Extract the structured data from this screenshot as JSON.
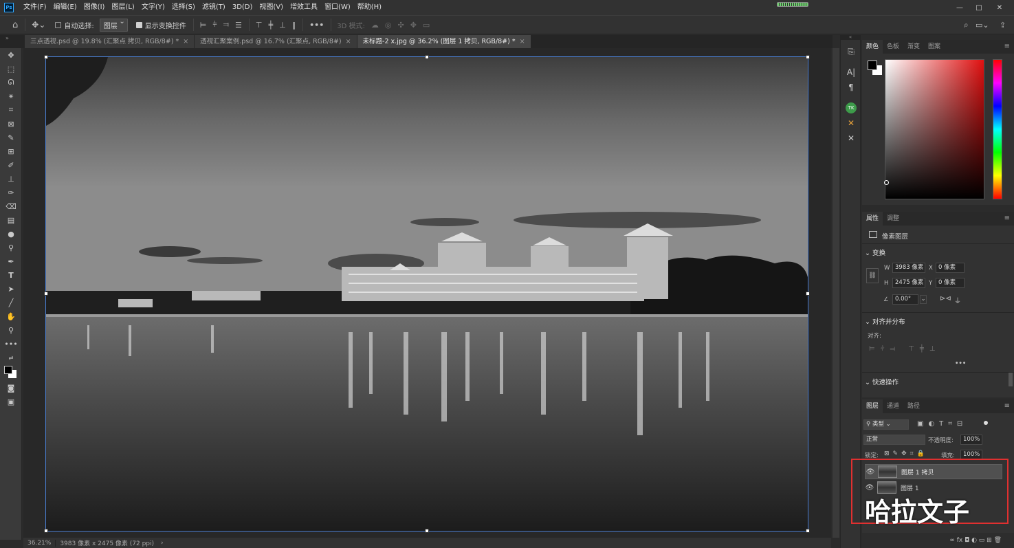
{
  "app": {
    "logo": "Ps"
  },
  "menu": [
    "文件(F)",
    "编辑(E)",
    "图像(I)",
    "图层(L)",
    "文字(Y)",
    "选择(S)",
    "滤镜(T)",
    "3D(D)",
    "视图(V)",
    "增效工具",
    "窗口(W)",
    "帮助(H)"
  ],
  "window_controls": {
    "minimize": "—",
    "restore": "□",
    "close": "✕"
  },
  "options": {
    "auto_select_label": "自动选择:",
    "auto_select_value": "图层",
    "show_transform_label": "显示变换控件",
    "more": "•••",
    "mode_3d_label": "3D 模式:"
  },
  "tabs": [
    {
      "label": "三点透视.psd @ 19.8% (汇聚点 拷贝, RGB/8#) *",
      "close": "×"
    },
    {
      "label": "透视汇聚案例.psd @ 16.7% (汇聚点, RGB/8#)",
      "close": "×"
    },
    {
      "label": "未标题-2 x.jpg @ 36.2% (图层 1 拷贝, RGB/8#) *",
      "close": "×"
    }
  ],
  "status": {
    "zoom": "36.21%",
    "doc_info": "3983 像素 x 2475 像素 (72 ppi)",
    "arrow": "›"
  },
  "color_panel": {
    "tabs": [
      "颜色",
      "色板",
      "渐变",
      "图案"
    ]
  },
  "properties": {
    "tabs": [
      "属性",
      "调整"
    ],
    "layer_type": "像素图层",
    "transform_title": "变换",
    "w_label": "W",
    "w_value": "3983 像素",
    "x_label": "X",
    "x_value": "0 像素",
    "h_label": "H",
    "h_value": "2475 像素",
    "y_label": "Y",
    "y_value": "0 像素",
    "angle_value": "0.00°",
    "align_title": "对齐并分布",
    "align_label": "对齐:",
    "more": "•••",
    "quick_title": "快速操作"
  },
  "layers_panel": {
    "tabs": [
      "图层",
      "通道",
      "路径"
    ],
    "filter_kind": "类型",
    "blend_mode": "正常",
    "opacity_label": "不透明度:",
    "opacity_value": "100%",
    "lock_label": "锁定:",
    "fill_label": "填充:",
    "fill_value": "100%",
    "layers": [
      {
        "name": "图层 1 拷贝"
      },
      {
        "name": "图层 1"
      }
    ],
    "bottom_icons": "∞  fx  ◘  ◐  ▭  ⊞  🗑"
  },
  "watermark": "哈拉文子",
  "colors": {
    "highlight_box": "#e03030",
    "accent": "#31a8ff"
  }
}
